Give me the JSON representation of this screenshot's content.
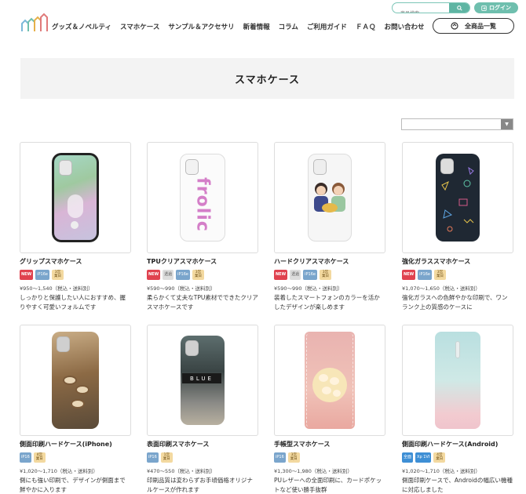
{
  "header": {
    "nav": [
      "グッズ＆ノベルティ",
      "スマホケース",
      "サンプル＆アクセサリ",
      "新着情報",
      "コラム",
      "ご利用ガイド",
      "ＦＡＱ",
      "お問い合わせ"
    ],
    "search_placeholder": "商品検索",
    "login_label": "ログイン",
    "all_products_label": "全商品一覧"
  },
  "page": {
    "title": "スマホケース"
  },
  "products": [
    {
      "name": "グリップスマホケース",
      "badges": [
        {
          "t": "NEW",
          "k": "new"
        },
        {
          "t": "iP16e",
          "k": "ip"
        },
        {
          "t": "3営業日",
          "k": "ship"
        }
      ],
      "price": "¥950～1,540（税込・送料別）",
      "desc": "しっかりと保護したい人におすすめ、握りやすく可愛いフォルムです"
    },
    {
      "name": "TPUクリアスマホケース",
      "badges": [
        {
          "t": "NEW",
          "k": "new"
        },
        {
          "t": "透過",
          "k": "clear"
        },
        {
          "t": "iP16e",
          "k": "ip"
        },
        {
          "t": "3営業日",
          "k": "ship"
        }
      ],
      "price": "¥590～990（税込・送料別）",
      "desc": "柔らかくて丈夫なTPU素材でできたクリアスマホケースです"
    },
    {
      "name": "ハードクリアスマホケース",
      "badges": [
        {
          "t": "NEW",
          "k": "new"
        },
        {
          "t": "透過",
          "k": "clear"
        },
        {
          "t": "iP16e",
          "k": "ip"
        },
        {
          "t": "3営業日",
          "k": "ship"
        }
      ],
      "price": "¥590～990（税込・送料別）",
      "desc": "装着したスマートフォンのカラーを活かしたデザインが楽しめます"
    },
    {
      "name": "強化ガラススマホケース",
      "badges": [
        {
          "t": "NEW",
          "k": "new"
        },
        {
          "t": "iP16e",
          "k": "ip"
        },
        {
          "t": "3営業日",
          "k": "ship"
        }
      ],
      "price": "¥1,070～1,650（税込・送料別）",
      "desc": "強化ガラスへの色鮮やかな印刷で、ワンランク上の質感のケースに"
    },
    {
      "name": "側面印刷ハードケース(iPhone)",
      "badges": [
        {
          "t": "iP16",
          "k": "ip"
        },
        {
          "t": "4営業日",
          "k": "ship"
        }
      ],
      "price": "¥1,020～1,710（税込・送料別）",
      "desc": "側にも強い印刷で、デザインが側面まで鮮やかに入ります"
    },
    {
      "name": "表面印刷スマホケース",
      "badges": [
        {
          "t": "iP16",
          "k": "ip"
        },
        {
          "t": "1営業日",
          "k": "ship"
        }
      ],
      "price": "¥470～550（税込・送料別）",
      "desc": "印刷品質は変わらずお手頃価格オリジナルケースが作れます"
    },
    {
      "name": "手帳型スマホケース",
      "badges": [
        {
          "t": "iP16",
          "k": "ip"
        },
        {
          "t": "3営業日",
          "k": "ship"
        }
      ],
      "price": "¥1,300～1,980（税込・送料別）",
      "desc": "PUレザーへの全面印刷に、カードポケットなど使い勝手抜群"
    },
    {
      "name": "側面印刷ハードケース(Android)",
      "badges": [
        {
          "t": "全面",
          "k": "full"
        },
        {
          "t": "Xp 1VI",
          "k": "xp"
        },
        {
          "t": "4営業日",
          "k": "ship"
        }
      ],
      "price": "¥1,020～1,710（税込・送料別）",
      "desc": "側面印刷ケースで、Androidの幅広い機種に対応しました"
    }
  ],
  "thumb_texts": {
    "tpu_text": "frolic",
    "blue_text": "BLUE"
  },
  "colors": {
    "accent": "#5fb5a3",
    "new_badge": "#e0424f",
    "model_badge": "#7aa5cc"
  }
}
